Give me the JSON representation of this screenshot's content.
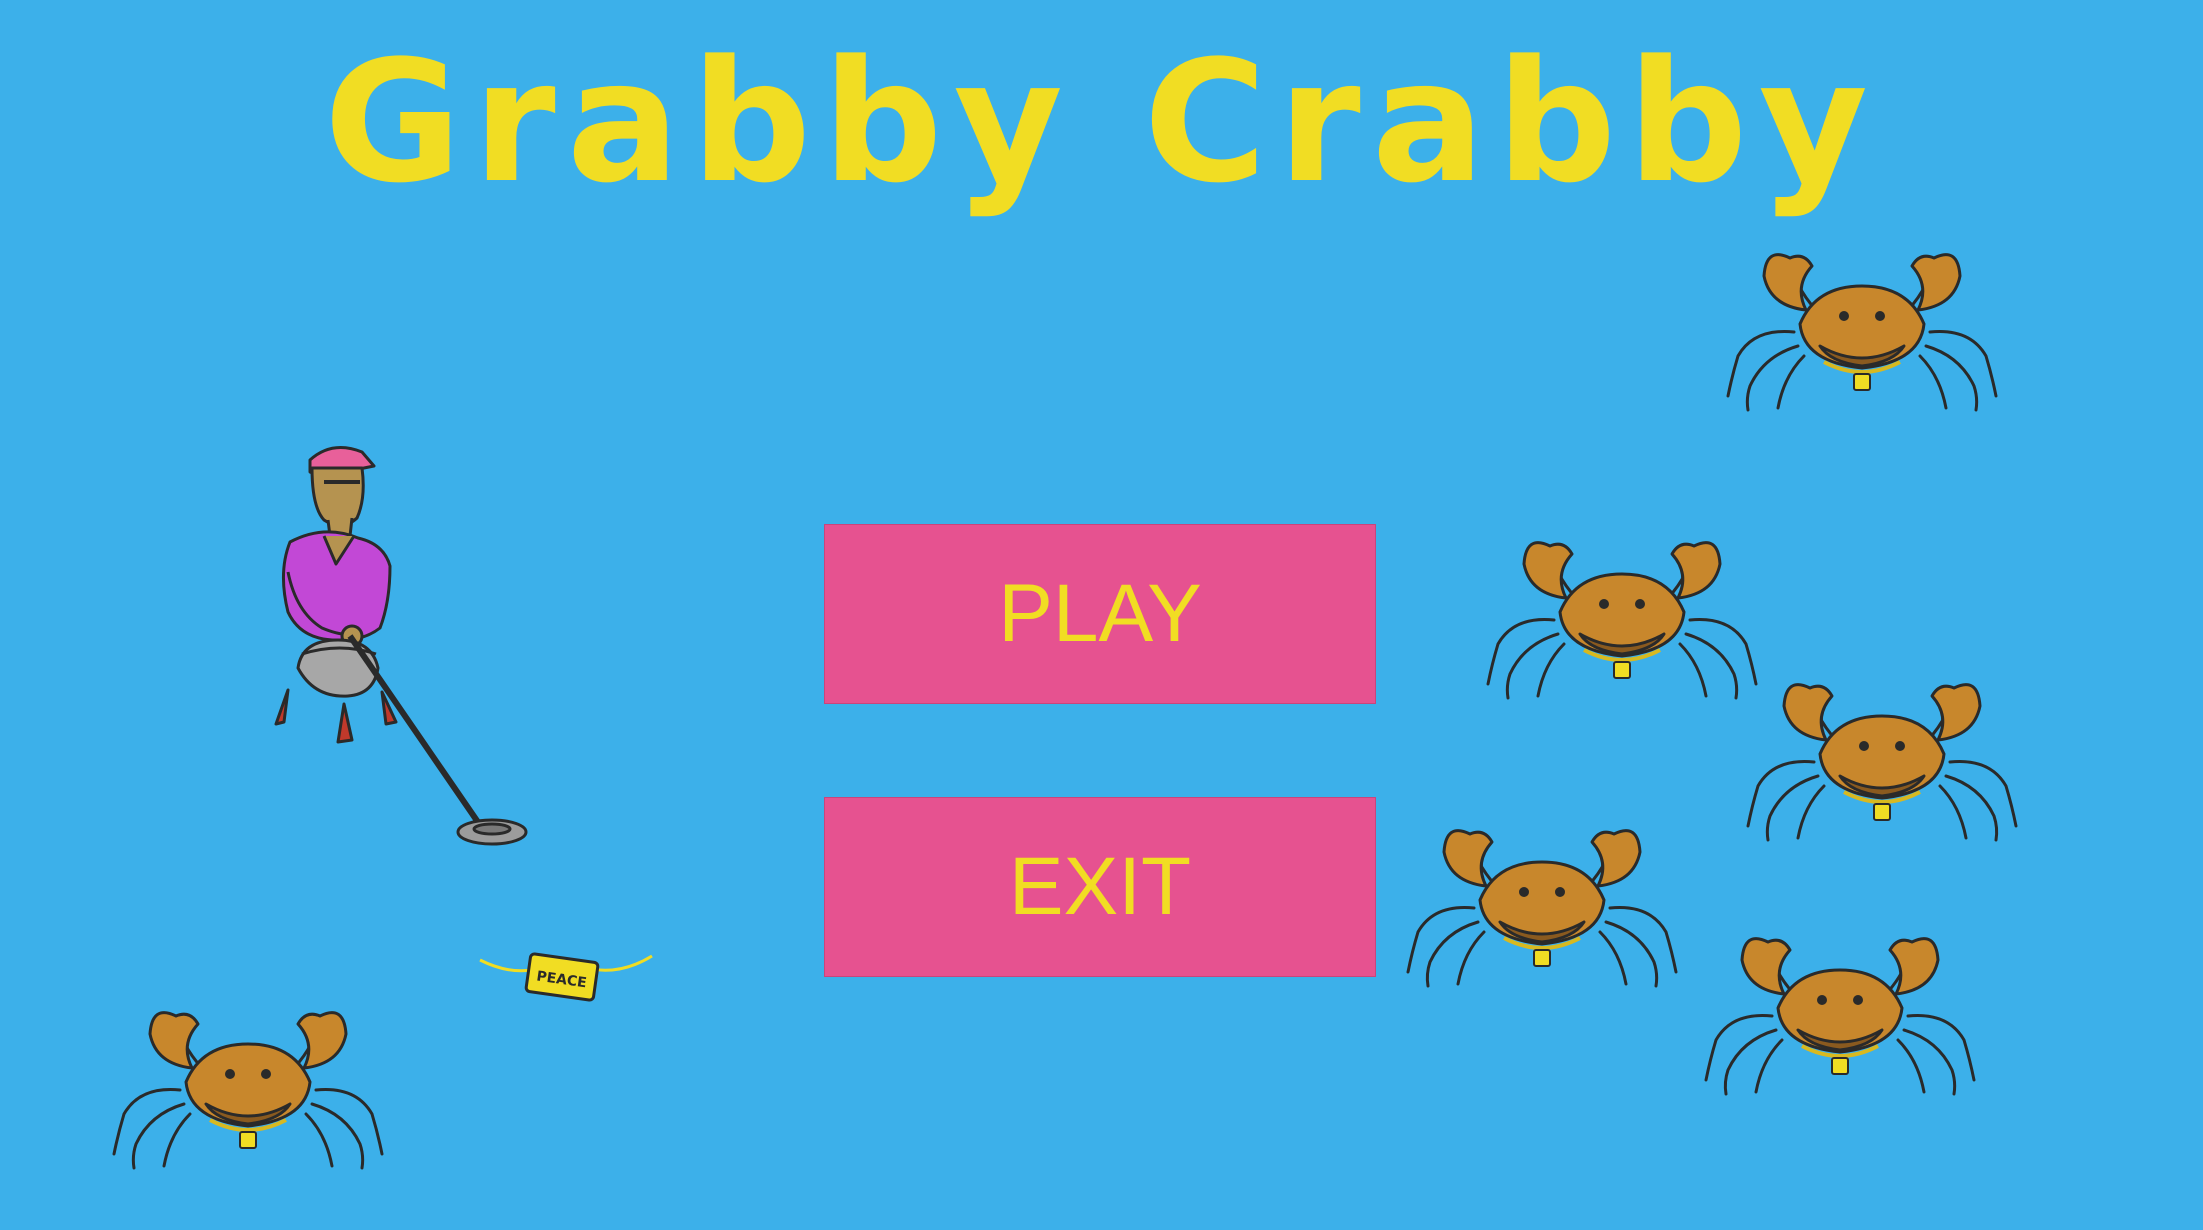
{
  "game": {
    "title": "Grabby Crabby",
    "menu": {
      "play_label": "PLAY",
      "exit_label": "EXIT"
    },
    "items": {
      "necklace_tag": "PEACE"
    },
    "sprites": [
      "metal-detectorist-player",
      "crab-enemy",
      "peace-necklace"
    ]
  },
  "colors": {
    "background": "#3cb0ea",
    "title": "#f1dd23",
    "button_fill": "#e65290",
    "button_text": "#f1dd23",
    "crab_shell": "#c8872c",
    "crab_dark": "#8a5a1f",
    "player_shirt": "#c248d6",
    "player_cap": "#e8609a",
    "necklace_gold": "#f1dd23"
  }
}
